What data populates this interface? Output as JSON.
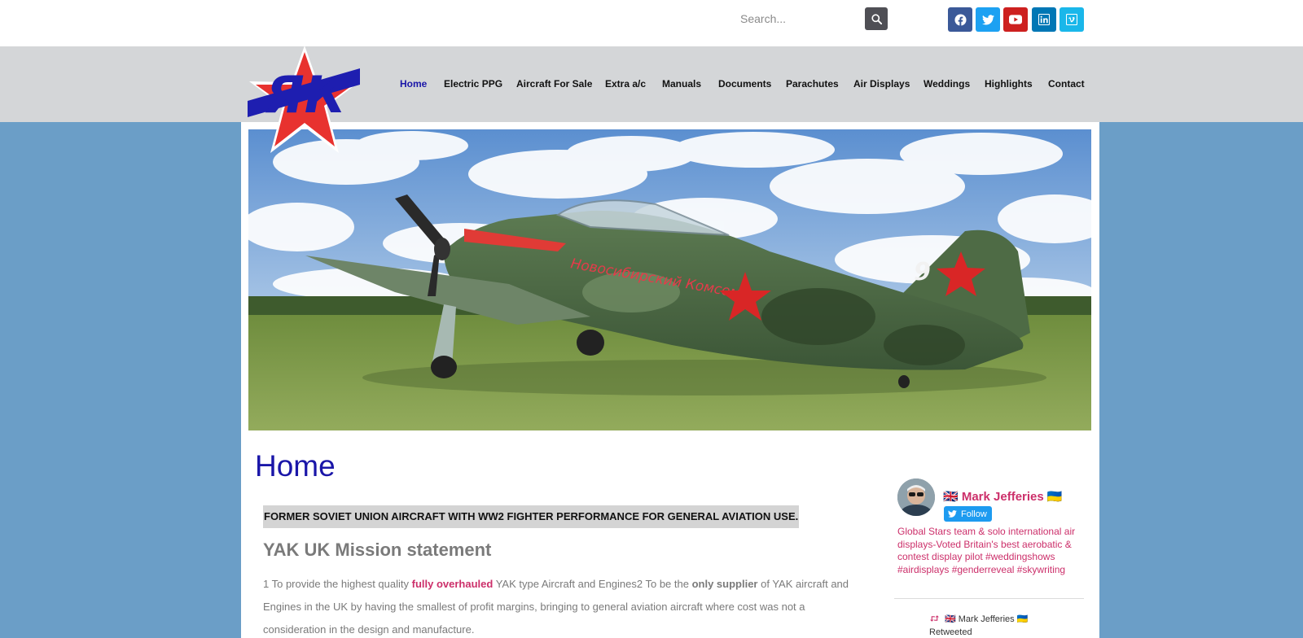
{
  "header": {
    "search": {
      "placeholder": "Search...",
      "value": ""
    },
    "social": [
      {
        "name": "facebook-icon",
        "color": "#3b5998"
      },
      {
        "name": "twitter-icon",
        "color": "#1da1f2"
      },
      {
        "name": "youtube-icon",
        "color": "#cd201f"
      },
      {
        "name": "linkedin-icon",
        "color": "#0077b5"
      },
      {
        "name": "vimeo-icon",
        "color": "#1ab7ea"
      }
    ]
  },
  "logo": {
    "text": "ЯК"
  },
  "nav": {
    "items": [
      {
        "label": "Home",
        "active": true
      },
      {
        "label": "Electric PPG"
      },
      {
        "label": "Aircraft For Sale"
      },
      {
        "label": "Extra a/c"
      },
      {
        "label": "Manuals"
      },
      {
        "label": "Documents"
      },
      {
        "label": "Parachutes"
      },
      {
        "label": "Air Displays"
      },
      {
        "label": "Weddings"
      },
      {
        "label": "Highlights"
      },
      {
        "label": "Contact"
      }
    ]
  },
  "hero": {
    "aircraft_text": "Новосибирский Комсомол",
    "tail_number": "9"
  },
  "main": {
    "title": "Home",
    "banner": "FORMER SOVIET UNION AIRCRAFT WITH WW2 FIGHTER PERFORMANCE FOR GENERAL AVIATION USE.",
    "mission_heading": "YAK UK Mission statement",
    "para": {
      "t1": "1 To provide the highest quality ",
      "t2": "fully overhauled",
      "t3": " YAK type Aircraft and Engines2 To be the ",
      "t4": "only supplier",
      "t5": " of YAK aircraft and Engines in the UK by having the smallest of profit margins, bringing to general aviation aircraft where cost was not a consideration in the design and manufacture."
    }
  },
  "twitter": {
    "name": "🇬🇧 Mark Jefferies 🇺🇦",
    "follow_label": "Follow",
    "bio": "Global Stars team & solo international air displays-Voted Britain's best aerobatic & contest display pilot #weddingshows #airdisplays #genderreveal #skywriting",
    "retweet_by": "🇬🇧 Mark Jefferies 🇺🇦",
    "retweet_label": "Retweeted"
  },
  "colors": {
    "accent_blue": "#1a16a8",
    "pink": "#cc2f6a",
    "background": "#6b9ec7",
    "nav_bg": "#d4d6d8"
  }
}
